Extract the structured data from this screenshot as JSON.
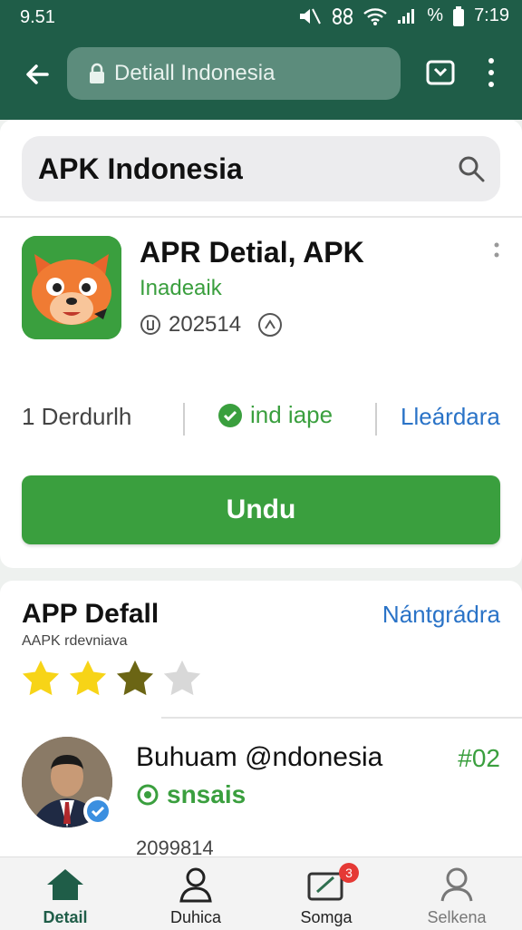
{
  "status_bar": {
    "time_left": "9.51",
    "time_right": "7:19",
    "signal_text": "%"
  },
  "browser": {
    "url_text": "Detiall Indonesia"
  },
  "search": {
    "query": "APK Indonesia"
  },
  "app": {
    "title": "APR Detial, APK",
    "developer": "Inadeaik",
    "version_meta": "202514",
    "icon": "fox-mascot-icon",
    "stats": {
      "downloads": "1 Derdurlh",
      "verified_label": "ind iape",
      "link_label": "Lleárdara"
    },
    "install_label": "Undu"
  },
  "details": {
    "title": "APP Defall",
    "link": "Nántgrádra",
    "subtitle": "AAPK rdevniava",
    "rating": {
      "filled": 2,
      "half": 1,
      "total": 4
    }
  },
  "review": {
    "name": "Buhuam @ndonesia",
    "rank": "#02",
    "status": "snsais",
    "meta": "2099814"
  },
  "nav": {
    "items": [
      {
        "label": "Detail",
        "icon": "home-icon",
        "active": true
      },
      {
        "label": "Duhica",
        "icon": "person-icon"
      },
      {
        "label": "Somga",
        "icon": "message-edit-icon",
        "badge": "3"
      },
      {
        "label": "Selkena",
        "icon": "profile-icon"
      }
    ]
  },
  "colors": {
    "primary_green": "#3a9f3e",
    "topbar": "#1f5d48",
    "link_blue": "#2a73c7"
  }
}
